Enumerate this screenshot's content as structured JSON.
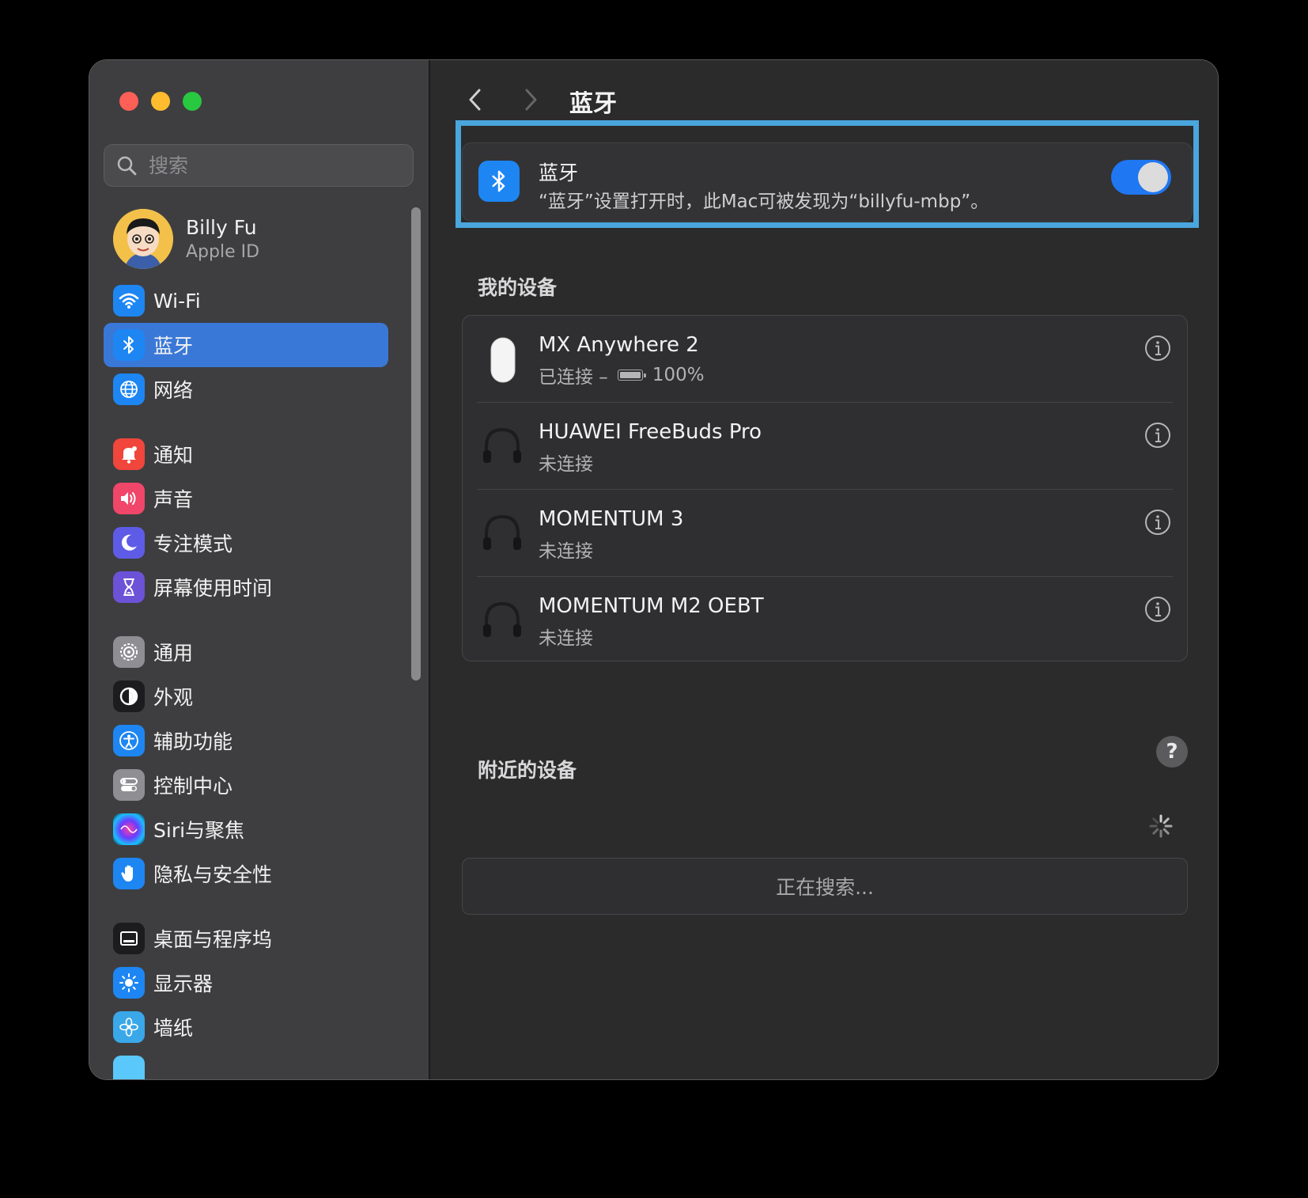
{
  "sidebar": {
    "search_placeholder": "搜索",
    "profile": {
      "name": "Billy Fu",
      "subtitle": "Apple ID"
    },
    "items": [
      {
        "label": "Wi-Fi",
        "icon": "wifi-icon",
        "color": "#1d86f3"
      },
      {
        "label": "蓝牙",
        "icon": "bluetooth-icon",
        "color": "#1d86f3",
        "active": true
      },
      {
        "label": "网络",
        "icon": "globe-icon",
        "color": "#1d86f3"
      },
      {
        "label": "通知",
        "icon": "bell-icon",
        "color": "#f0463c"
      },
      {
        "label": "声音",
        "icon": "speaker-icon",
        "color": "#f0466a"
      },
      {
        "label": "专注模式",
        "icon": "moon-icon",
        "color": "#5e5ce6"
      },
      {
        "label": "屏幕使用时间",
        "icon": "hourglass-icon",
        "color": "#6b52d6"
      },
      {
        "label": "通用",
        "icon": "gear-icon",
        "color": "#8e8e93"
      },
      {
        "label": "外观",
        "icon": "appearance-icon",
        "color": "#1c1c1e"
      },
      {
        "label": "辅助功能",
        "icon": "accessibility-icon",
        "color": "#1d86f3"
      },
      {
        "label": "控制中心",
        "icon": "control-center-icon",
        "color": "#8e8e93"
      },
      {
        "label": "Siri与聚焦",
        "icon": "siri-icon",
        "color": "#2a2a6a"
      },
      {
        "label": "隐私与安全性",
        "icon": "hand-icon",
        "color": "#1d86f3"
      },
      {
        "label": "桌面与程序坞",
        "icon": "dock-icon",
        "color": "#1c1c1e"
      },
      {
        "label": "显示器",
        "icon": "sun-icon",
        "color": "#1d86f3"
      },
      {
        "label": "墙纸",
        "icon": "flower-icon",
        "color": "#3aa7e8"
      },
      {
        "label": "",
        "icon": "screensaver-icon",
        "color": "#5ac8fa"
      }
    ]
  },
  "main": {
    "title": "蓝牙",
    "bluetooth": {
      "title": "蓝牙",
      "description": "“蓝牙”设置打开时，此Mac可被发现为“billyfu-mbp”。",
      "enabled": true
    },
    "my_devices_title": "我的设备",
    "devices": [
      {
        "name": "MX Anywhere 2",
        "status": "已连接 –",
        "battery": "100%",
        "icon": "mouse-icon"
      },
      {
        "name": "HUAWEI FreeBuds Pro",
        "status": "未连接",
        "icon": "headphones-icon"
      },
      {
        "name": "MOMENTUM 3",
        "status": "未连接",
        "icon": "headphones-icon"
      },
      {
        "name": "MOMENTUM M2 OEBT",
        "status": "未连接",
        "icon": "headphones-icon"
      }
    ],
    "help_label": "?",
    "nearby_title": "附近的设备",
    "searching": "正在搜索..."
  }
}
